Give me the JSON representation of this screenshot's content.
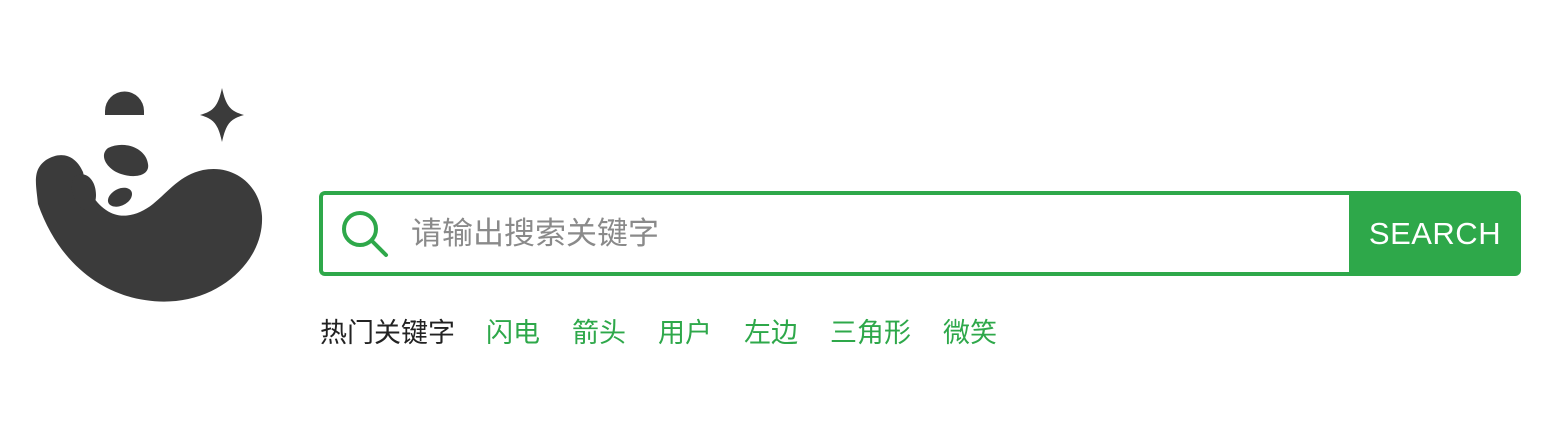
{
  "brand": {
    "logo_icon": "panda-star-icon"
  },
  "search": {
    "placeholder": "请输出搜索关键字",
    "value": "",
    "button_label": "SEARCH",
    "icon": "search-icon",
    "accent_color": "#2ea84a"
  },
  "hot_keywords": {
    "label": "热门关键字",
    "items": [
      {
        "label": "闪电"
      },
      {
        "label": "箭头"
      },
      {
        "label": "用户"
      },
      {
        "label": "左边"
      },
      {
        "label": "三角形"
      },
      {
        "label": "微笑"
      }
    ]
  }
}
